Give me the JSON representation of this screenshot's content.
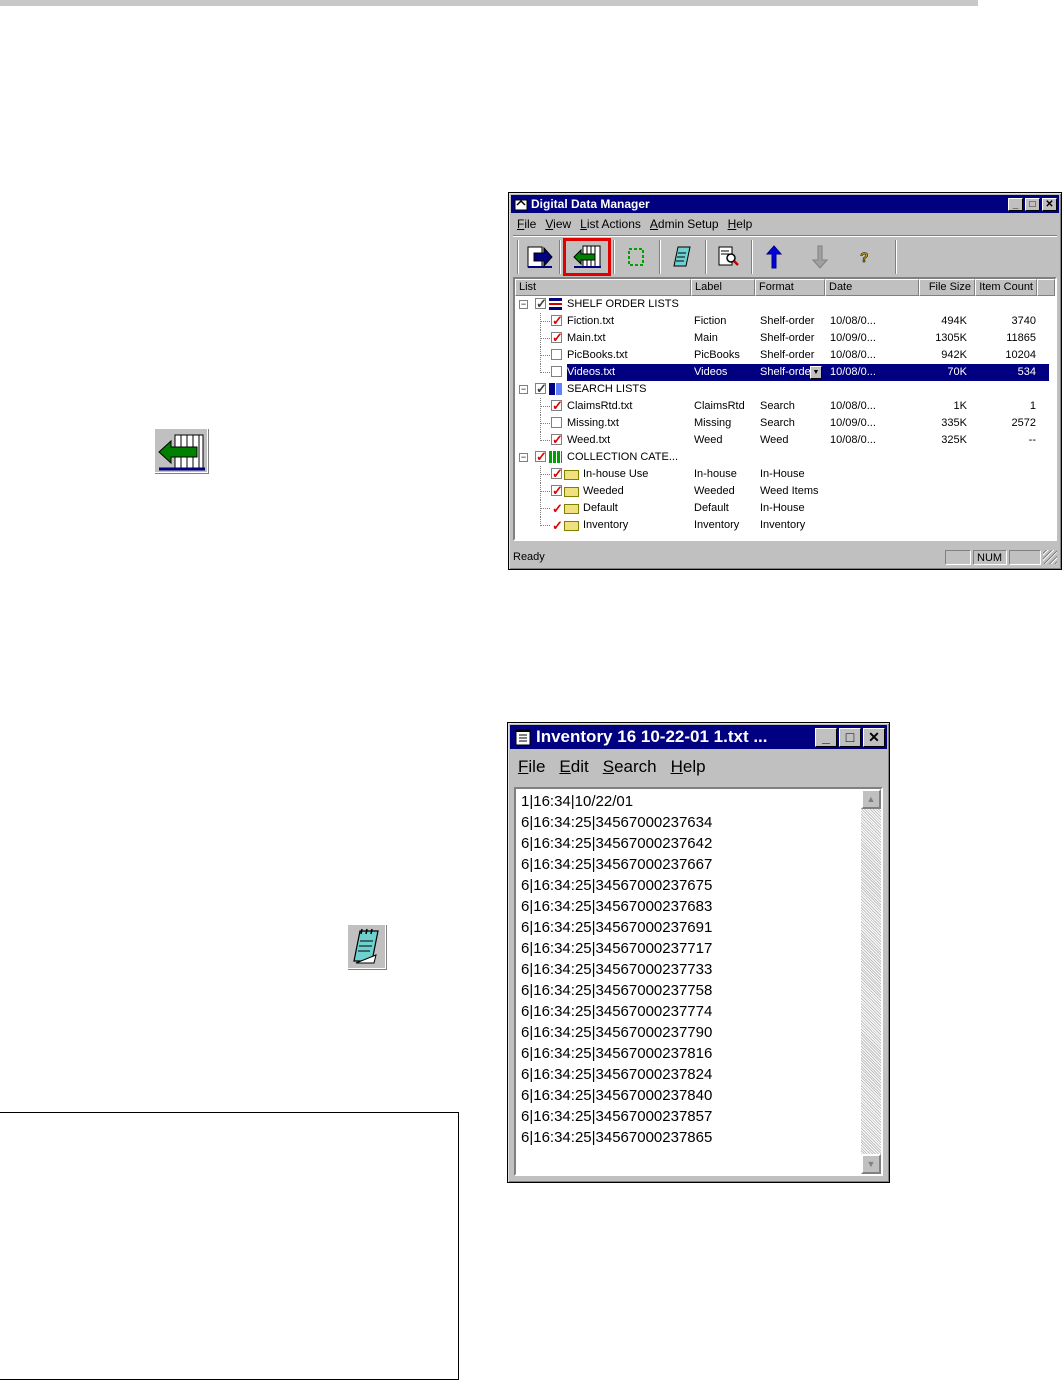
{
  "ddm": {
    "title": "Digital Data Manager",
    "menu": [
      {
        "ul": "F",
        "rest": "ile"
      },
      {
        "ul": "V",
        "rest": "iew"
      },
      {
        "ul": "L",
        "rest": "ist Actions"
      },
      {
        "ul": "A",
        "rest": "dmin Setup"
      },
      {
        "ul": "H",
        "rest": "elp"
      }
    ],
    "toolbar_icons": [
      "send-arrow-icon",
      "receive-arrow-icon",
      "refresh-icon",
      "notepad-icon",
      "view-document-icon",
      "move-up-icon",
      "move-down-icon",
      "help-icon"
    ],
    "columns": [
      "List",
      "Label",
      "Format",
      "Date",
      "File Size",
      "Item Count"
    ],
    "groups": [
      {
        "name": "SHELF ORDER LISTS",
        "rows": [
          {
            "name": "Fiction.txt",
            "label": "Fiction",
            "format": "Shelf-order",
            "date": "10/08/0...",
            "size": "494K",
            "count": "3740",
            "checked": true
          },
          {
            "name": "Main.txt",
            "label": "Main",
            "format": "Shelf-order",
            "date": "10/09/0...",
            "size": "1305K",
            "count": "11865",
            "checked": true
          },
          {
            "name": "PicBooks.txt",
            "label": "PicBooks",
            "format": "Shelf-order",
            "date": "10/08/0...",
            "size": "942K",
            "count": "10204",
            "checked": false
          },
          {
            "name": "Videos.txt",
            "label": "Videos",
            "format": "Shelf-orde",
            "date": "10/08/0...",
            "size": "70K",
            "count": "534",
            "checked": false,
            "selected": true
          }
        ]
      },
      {
        "name": "SEARCH LISTS",
        "rows": [
          {
            "name": "ClaimsRtd.txt",
            "label": "ClaimsRtd",
            "format": "Search",
            "date": "10/08/0...",
            "size": "1K",
            "count": "1",
            "checked": true
          },
          {
            "name": "Missing.txt",
            "label": "Missing",
            "format": "Search",
            "date": "10/09/0...",
            "size": "335K",
            "count": "2572",
            "checked": false
          },
          {
            "name": "Weed.txt",
            "label": "Weed",
            "format": "Weed",
            "date": "10/08/0...",
            "size": "325K",
            "count": "--",
            "checked": true
          }
        ]
      },
      {
        "name": "COLLECTION CATE...",
        "rows": [
          {
            "name": "In-house Use",
            "label": "In-house",
            "format": "In-House",
            "checked": true,
            "folder": true,
            "box": true
          },
          {
            "name": "Weeded",
            "label": "Weeded",
            "format": "Weed Items",
            "checked": true,
            "folder": true,
            "box": true
          },
          {
            "name": "Default",
            "label": "Default",
            "format": "In-House",
            "checked": true,
            "folder": true,
            "box": false
          },
          {
            "name": "Inventory",
            "label": "Inventory",
            "format": "Inventory",
            "checked": true,
            "folder": true,
            "box": false
          }
        ]
      }
    ],
    "status": {
      "text": "Ready",
      "num": "NUM"
    }
  },
  "notepad": {
    "title": "Inventory 16 10-22-01 1.txt ...",
    "menu": [
      {
        "ul": "F",
        "rest": "ile"
      },
      {
        "ul": "E",
        "rest": "dit"
      },
      {
        "ul": "S",
        "rest": "earch"
      },
      {
        "ul": "H",
        "rest": "elp"
      }
    ],
    "lines": [
      "1|16:34|10/22/01",
      "6|16:34:25|34567000237634",
      "6|16:34:25|34567000237642",
      "6|16:34:25|34567000237667",
      "6|16:34:25|34567000237675",
      "6|16:34:25|34567000237683",
      "6|16:34:25|34567000237691",
      "6|16:34:25|34567000237717",
      "6|16:34:25|34567000237733",
      "6|16:34:25|34567000237758",
      "6|16:34:25|34567000237774",
      "6|16:34:25|34567000237790",
      "6|16:34:25|34567000237816",
      "6|16:34:25|34567000237824",
      "6|16:34:25|34567000237840",
      "6|16:34:25|34567000237857",
      "6|16:34:25|34567000237865"
    ]
  },
  "colors": {
    "titlebar": "#000080",
    "highlight": "#e00000",
    "chrome": "#c0c0c0"
  }
}
